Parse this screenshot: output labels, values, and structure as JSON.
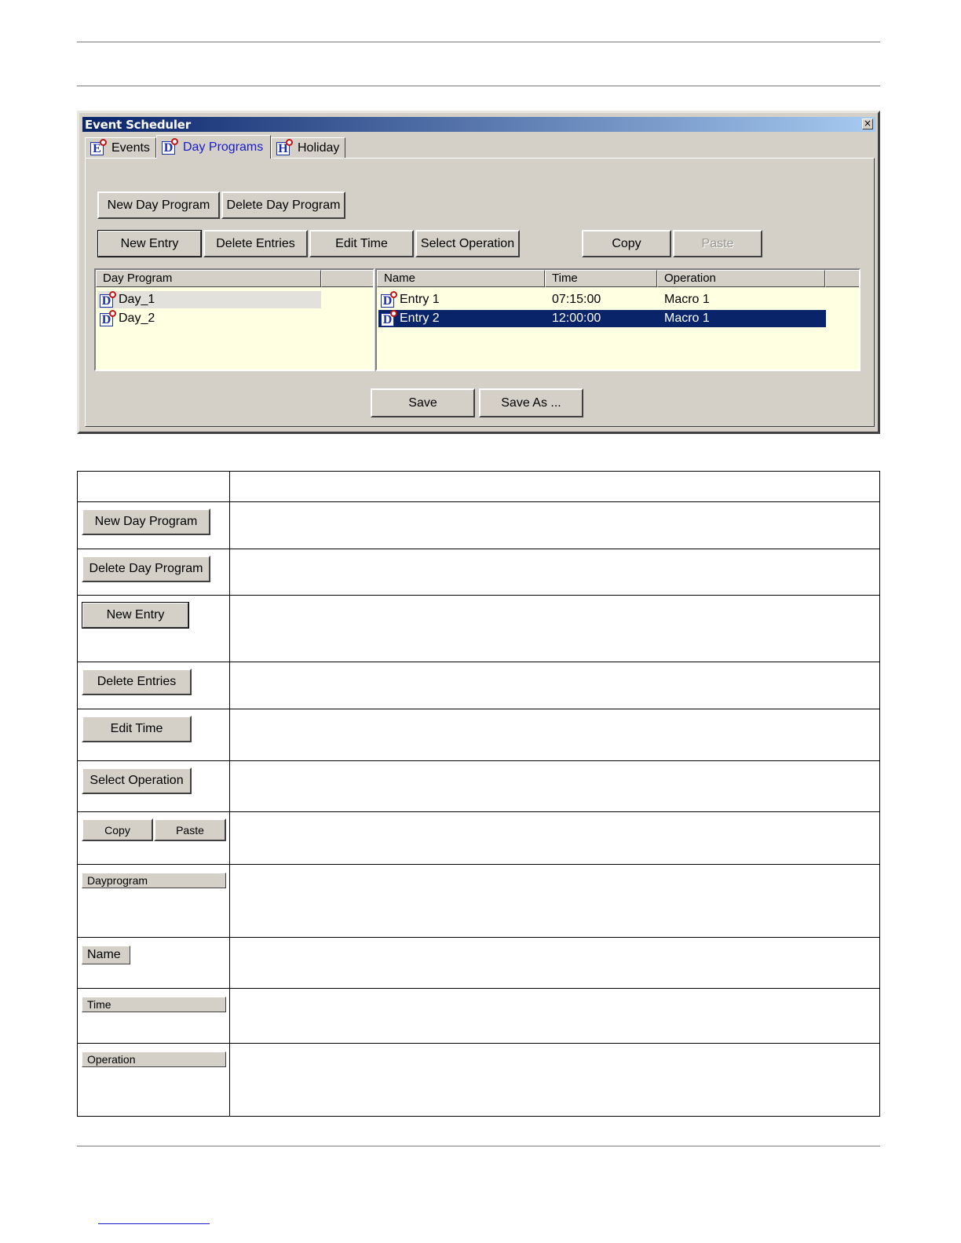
{
  "dialog": {
    "title": "Event Scheduler",
    "close_glyph": "×",
    "tabs": [
      {
        "label": "Events",
        "icon_letter": "E",
        "active": false
      },
      {
        "label": "Day Programs",
        "icon_letter": "D",
        "active": true
      },
      {
        "label": "Holiday",
        "icon_letter": "H",
        "active": false
      }
    ],
    "buttons": {
      "new_day_program": "New Day Program",
      "delete_day_program": "Delete Day Program",
      "new_entry": "New Entry",
      "delete_entries": "Delete Entries",
      "edit_time": "Edit Time",
      "select_operation": "Select Operation",
      "copy": "Copy",
      "paste": "Paste",
      "save": "Save",
      "save_as": "Save As ..."
    },
    "day_list": {
      "header": "Day Program",
      "items": [
        {
          "label": "Day_1",
          "icon_letter": "D",
          "selected": true
        },
        {
          "label": "Day_2",
          "icon_letter": "D",
          "selected": false
        }
      ]
    },
    "entry_list": {
      "columns": [
        "Name",
        "Time",
        "Operation"
      ],
      "rows": [
        {
          "name": "Entry 1",
          "time": "07:15:00",
          "operation": "Macro 1",
          "icon_letter": "D",
          "selected": false
        },
        {
          "name": "Entry 2",
          "time": "12:00:00",
          "operation": "Macro 1",
          "icon_letter": "D",
          "selected": true
        }
      ]
    }
  },
  "description_table": {
    "rows": [
      {
        "kind": "button",
        "label": "New Day Program"
      },
      {
        "kind": "button",
        "label": "Delete Day Program"
      },
      {
        "kind": "button",
        "label": "New Entry"
      },
      {
        "kind": "button",
        "label": "Delete Entries"
      },
      {
        "kind": "button",
        "label": "Edit Time"
      },
      {
        "kind": "button",
        "label": "Select Operation"
      },
      {
        "kind": "button-pair",
        "labels": [
          "Copy",
          "Paste"
        ]
      },
      {
        "kind": "header",
        "label": "Dayprogram"
      },
      {
        "kind": "header",
        "label": "Name"
      },
      {
        "kind": "header",
        "label": "Time"
      },
      {
        "kind": "header",
        "label": "Operation"
      }
    ]
  },
  "colors": {
    "dialog_face": "#d4d0c8",
    "title_gradient_start": "#0a246a",
    "title_gradient_end": "#a6caf0",
    "list_background": "#ffffe1",
    "selection": "#0a246a",
    "active_tab_text": "#1a1acc",
    "icon_pin": "#c41212"
  }
}
